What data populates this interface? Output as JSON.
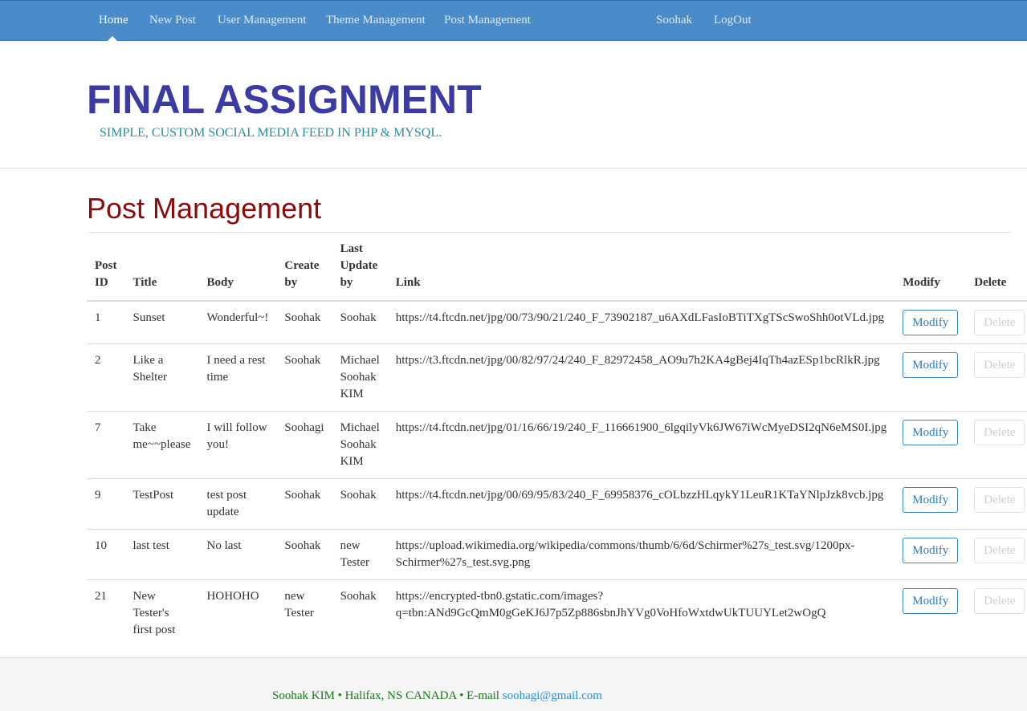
{
  "navbar": {
    "items": [
      {
        "label": "Home"
      },
      {
        "label": "New Post"
      },
      {
        "label": "User Management"
      },
      {
        "label": "Theme Management"
      },
      {
        "label": "Post Management"
      }
    ],
    "user_label": "Soohak",
    "logout_label": "LogOut"
  },
  "header": {
    "title": "FINAL ASSIGNMENT",
    "tagline": "SIMPLE, CUSTOM SOCIAL MEDIA FEED IN PHP & MYSQL."
  },
  "page": {
    "heading": "Post Management"
  },
  "table": {
    "headers": {
      "post_id": "Post ID",
      "title": "Title",
      "body": "Body",
      "create_by": "Create by",
      "last_update_by": "Last Update by",
      "link": "Link",
      "modify": "Modify",
      "delete": "Delete"
    },
    "rows": [
      {
        "id": "1",
        "title": "Sunset",
        "body": "Wonderful~!",
        "create_by": "Soohak",
        "update_by": "Soohak",
        "link": "https://t4.ftcdn.net/jpg/00/73/90/21/240_F_73902187_u6AXdLFasIoBTiTXgTScSwoShh0otVLd.jpg"
      },
      {
        "id": "2",
        "title": "Like a Shelter",
        "body": "I need a rest time",
        "create_by": "Soohak",
        "update_by": "Michael Soohak KIM",
        "link": "https://t3.ftcdn.net/jpg/00/82/97/24/240_F_82972458_AO9u7h2KA4gBej4IqTh4azESp1bcRlkR.jpg"
      },
      {
        "id": "7",
        "title": "Take me~~please",
        "body": "I will follow you!",
        "create_by": "Soohagi",
        "update_by": "Michael Soohak KIM",
        "link": "https://t4.ftcdn.net/jpg/01/16/66/19/240_F_116661900_6lgqilyVk6JW67iWcMyeDSI2qN6eMS0I.jpg"
      },
      {
        "id": "9",
        "title": "TestPost",
        "body": "test post update",
        "create_by": "Soohak",
        "update_by": "Soohak",
        "link": "https://t4.ftcdn.net/jpg/00/69/95/83/240_F_69958376_cOLbzzHLqykY1LeuR1KTaYNlpJzk8vcb.jpg"
      },
      {
        "id": "10",
        "title": "last test",
        "body": "No last",
        "create_by": "Soohak",
        "update_by": "new Tester",
        "link": "https://upload.wikimedia.org/wikipedia/commons/thumb/6/6d/Schirmer%27s_test.svg/1200px-Schirmer%27s_test.svg.png"
      },
      {
        "id": "21",
        "title": "New Tester's first post",
        "body": "HOHOHO",
        "create_by": "new Tester",
        "update_by": "Soohak",
        "link": "https://encrypted-tbn0.gstatic.com/images?q=tbn:ANd9GcQmM0gGeKJ6J7p5Zp886sbnJhYVg0VoHfoWxtdwUkTUUYLet2wOgQ"
      }
    ],
    "modify_label": "Modify",
    "delete_label": "Delete"
  },
  "footer": {
    "text": "Soohak KIM • Halifax, NS CANADA • E-mail",
    "email": "soohagi@gmail.com"
  },
  "colors": {
    "navbar": "#4a8cc9",
    "title": "#3b3ba3",
    "tagline": "#2a8ea0",
    "heading": "#8b0a0a",
    "modify_button": "#2e7bbf",
    "footer_text": "#1a7a1a",
    "footer_link": "#2f8fd0"
  }
}
